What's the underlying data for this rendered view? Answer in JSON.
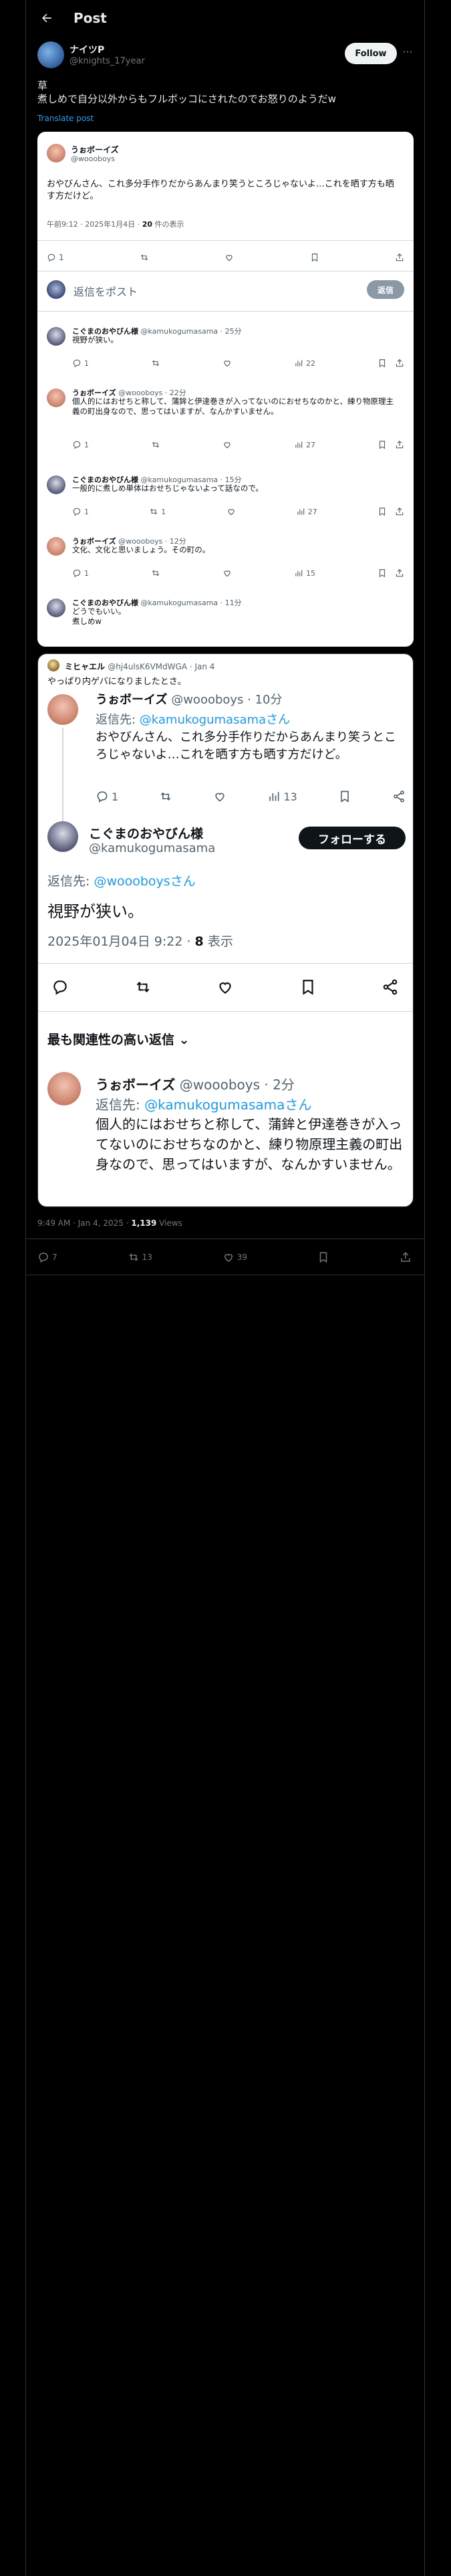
{
  "header": {
    "back_icon": "arrow-left-icon",
    "title": "Post"
  },
  "post": {
    "author_name": "ナイツP",
    "author_handle": "@knights_17year",
    "follow_label": "Follow",
    "more_icon": "more-horizontal-icon",
    "text_line1": "草",
    "text_line2": "煮しめで自分以外からもフルボッコにされたのでお怒りのようだw",
    "translate_label": "Translate post",
    "time": "9:49 AM · Jan 4, 2025",
    "views_count": "1,139",
    "views_label": "Views",
    "actions": {
      "reply": "7",
      "repost": "13",
      "like": "39"
    }
  },
  "screenshot1": {
    "name": "うぉボーイズ",
    "handle": "@woooboys",
    "body": "おやびんさん、これ多分手作りだからあんまり笑うところじゃないよ…これを晒す方も晒す方だけど。",
    "meta_time": "午前9:12 · 2025年1月4日 · ",
    "meta_views": "20",
    "meta_views_label": " 件の表示",
    "reply_count": "1",
    "reply_placeholder": "返信をポスト",
    "reply_button": "返信",
    "comments": [
      {
        "name": "こぐまのおやびん様",
        "handle": "@kamukogumasama · 25分",
        "text": "視野が狭い。",
        "reply": "1",
        "repost": "",
        "like": "",
        "views": "22"
      },
      {
        "name": "うぉボーイズ",
        "handle": "@woooboys · 22分",
        "text": "個人的にはおせちと称して、蒲鉾と伊達巻きが入ってないのにおせちなのかと、練り物原理主義の町出身なので、思ってはいますが、なんかすいません。",
        "reply": "1",
        "repost": "",
        "like": "",
        "views": "27"
      },
      {
        "name": "こぐまのおやびん様",
        "handle": "@kamukogumasama · 15分",
        "text": "一般的に煮しめ単体はおせちじゃないよって話なので。",
        "reply": "1",
        "repost": "1",
        "like": "",
        "views": "27"
      },
      {
        "name": "うぉボーイズ",
        "handle": "@woooboys · 12分",
        "text": "文化、文化と思いましょう。その町の。",
        "reply": "1",
        "repost": "",
        "like": "",
        "views": "15"
      },
      {
        "name": "こぐまのおやびん様",
        "handle": "@kamukogumasama · 11分",
        "text": "どうでもいい。\n煮しめw",
        "reply": "",
        "repost": "",
        "like": "",
        "views": ""
      }
    ]
  },
  "quote": {
    "name": "ミヒャエル",
    "handle": "@hj4ulsK6VMdWGA · Jan 4",
    "text": "やっぱり内ゲバになりましたとさ。"
  },
  "screenshot2": {
    "frag_name": "うぉボーイズ",
    "frag_handle": "@woooboys · 10分",
    "frag_replyto_prefix": "返信先: ",
    "frag_replyto_mention": "@kamukogumasamaさん",
    "frag_text": "おやびんさん、これ多分手作りだからあんまり笑うところじゃないよ…これを晒す方も晒す方だけど。",
    "frag_reply": "1",
    "frag_views": "13",
    "main_name": "こぐまのおやびん様",
    "main_handle": "@kamukogumasama",
    "follow_label": "フォローする",
    "replyto_prefix": "返信先: ",
    "replyto_mention": "@woooboysさん",
    "body": "視野が狭い。",
    "meta_time": "2025年01月04日 9:22 · ",
    "meta_views": "8",
    "meta_views_label": " 表示",
    "relevant_label": "最も関連性の高い返信",
    "rel_name": "うぉボーイズ",
    "rel_handle": "@woooboys · 2分",
    "rel_replyto_prefix": "返信先: ",
    "rel_replyto_mention": "@kamukogumasamaさん",
    "rel_text": "個人的にはおせちと称して、蒲鉾と伊達巻きが入ってないのにおせちなのかと、練り物原理主義の町出身なので、思ってはいますが、なんかすいません。"
  }
}
